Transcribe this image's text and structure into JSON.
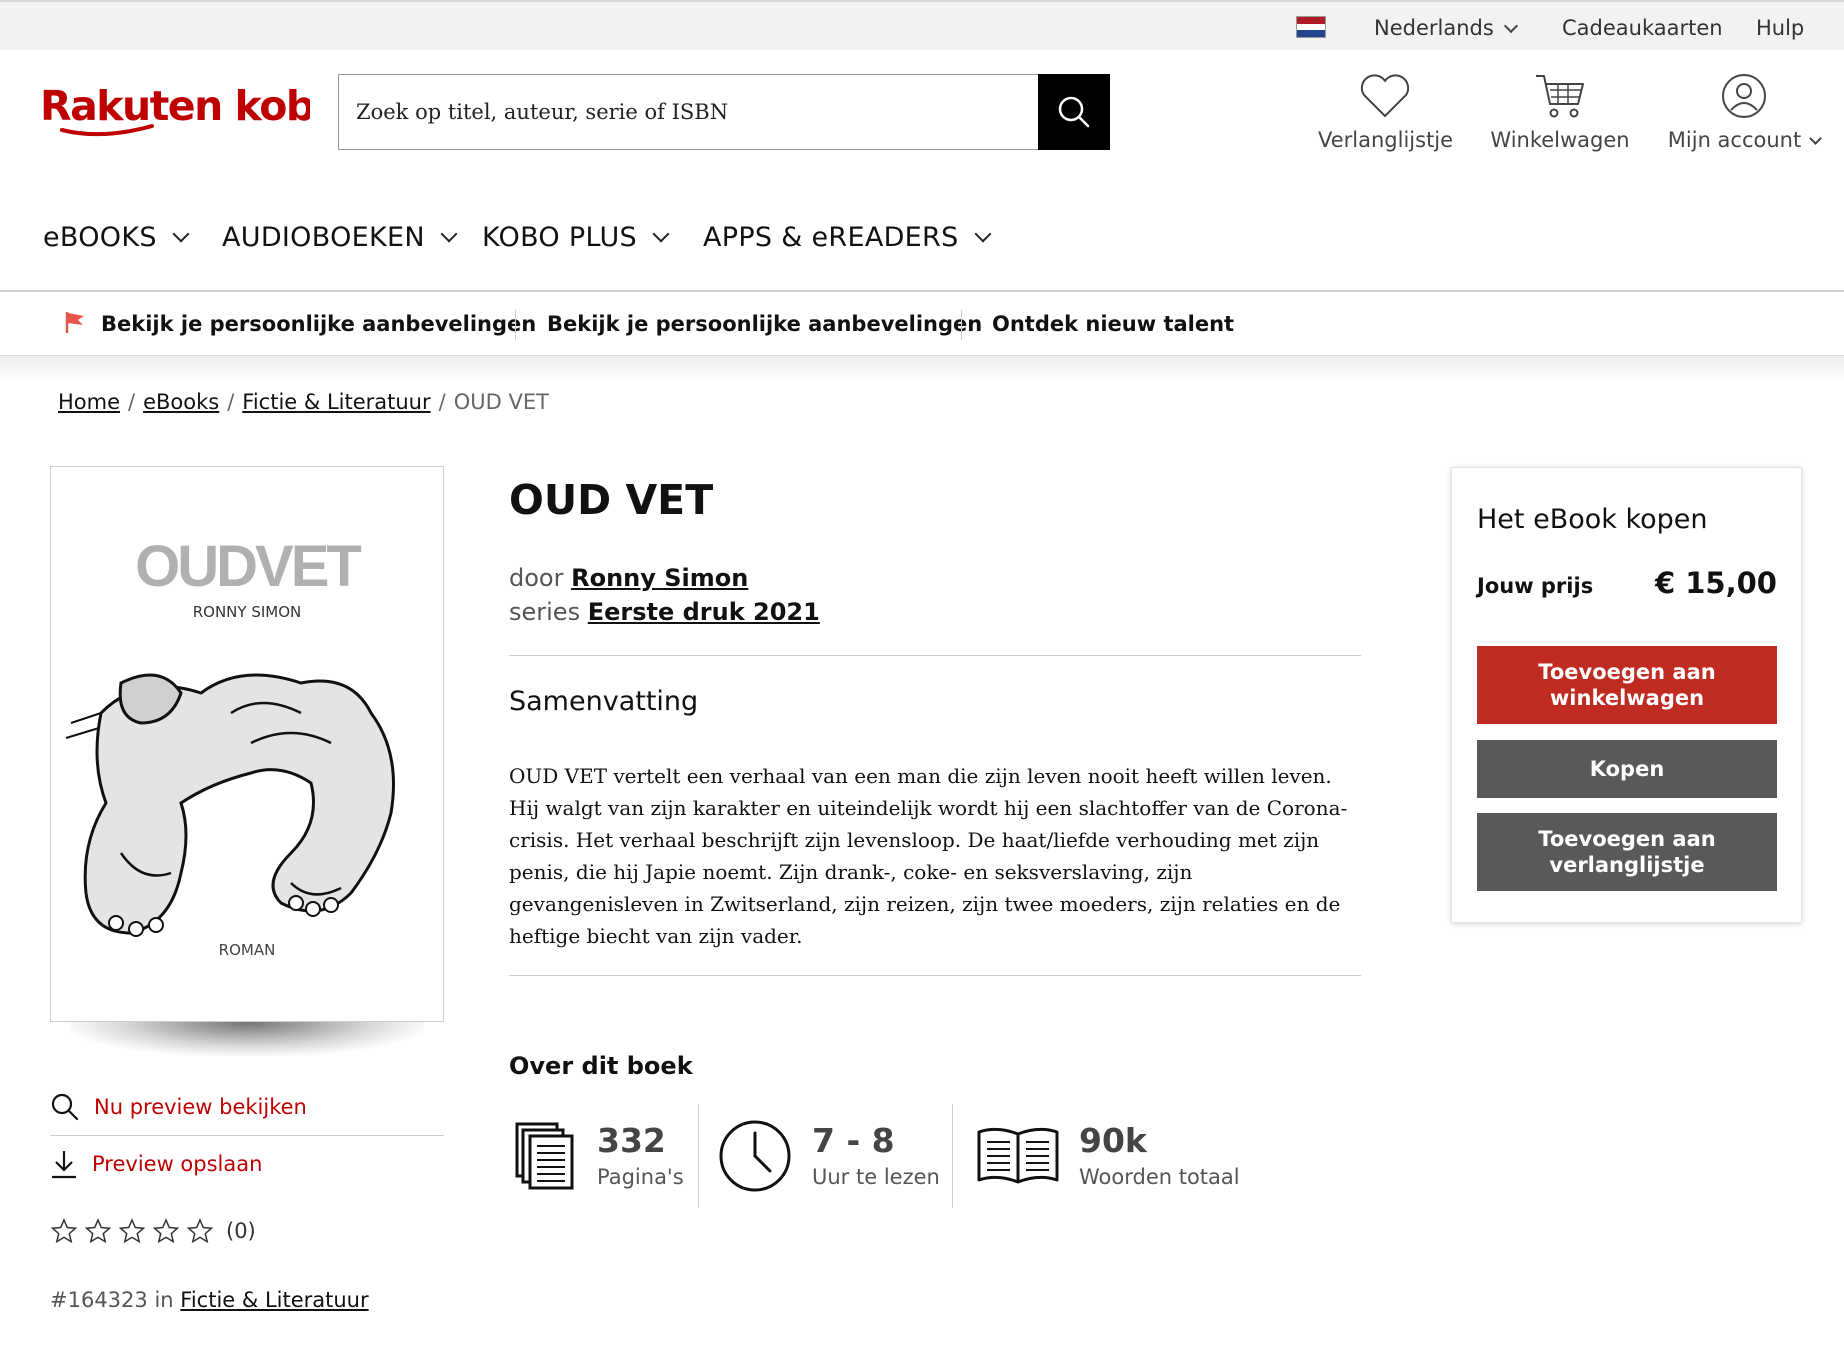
{
  "colors": {
    "brand_red": "#bf0000",
    "button_gray": "#595959",
    "link_red": "#bf0000",
    "utility_bg": "#f2f2f2"
  },
  "utility_bar": {
    "language": "Nederlands",
    "gift_cards": "Cadeaukaarten",
    "help": "Hulp",
    "flag_icon": "netherlands-flag-icon"
  },
  "header": {
    "logo_text": "Rakuten kobo",
    "search_placeholder": "Zoek op titel, auteur, serie of ISBN",
    "search_icon": "search-icon",
    "wishlist": "Verlanglijstje",
    "cart": "Winkelwagen",
    "account": "Mijn account"
  },
  "main_nav": [
    {
      "label": "eBOOKS"
    },
    {
      "label": "AUDIOBOEKEN"
    },
    {
      "label": "KOBO PLUS"
    },
    {
      "label": "APPS & eREADERS"
    }
  ],
  "promo_bar": [
    {
      "label": "Bekijk je persoonlijke aanbevelingen",
      "icon": "flag-icon"
    },
    {
      "label": "Bekijk je persoonlijke aanbevelingen"
    },
    {
      "label": "Ontdek nieuw talent"
    }
  ],
  "breadcrumb": {
    "items": [
      "Home",
      "eBooks",
      "Fictie & Literatuur"
    ],
    "current": "OUD VET",
    "separator": "/"
  },
  "cover": {
    "title": "OUDVET",
    "author": "RONNY SIMON",
    "label": "ROMAN"
  },
  "preview": {
    "view": "Nu preview bekijken",
    "save": "Preview opslaan"
  },
  "rating": {
    "stars_filled": 0,
    "stars_total": 5,
    "count": "(0)"
  },
  "rank": {
    "number": "#164323",
    "in": "in",
    "category": "Fictie & Literatuur"
  },
  "book": {
    "title": "OUD VET",
    "by_label": "door",
    "author": "Ronny Simon",
    "series_label": "series",
    "series": "Eerste druk 2021",
    "synopsis_heading": "Samenvatting",
    "synopsis": "OUD VET vertelt een verhaal van een man die zijn leven nooit heeft willen leven. Hij walgt van zijn karakter en uiteindelijk wordt hij een slachtoffer van de Corona-crisis. Het verhaal beschrijft zijn levensloop. De haat/liefde verhouding met zijn penis, die hij Japie noemt. Zijn drank-, coke- en seksverslaving, zijn gevangenisleven in Zwitserland, zijn reizen, zijn twee moeders, zijn relaties en de heftige biecht van zijn vader."
  },
  "about": {
    "heading": "Over dit boek",
    "stats": [
      {
        "value": "332",
        "label": "Pagina's",
        "icon": "pages-icon"
      },
      {
        "value": "7 - 8",
        "label": "Uur te lezen",
        "icon": "clock-icon"
      },
      {
        "value": "90k",
        "label": "Woorden totaal",
        "icon": "open-book-icon"
      }
    ]
  },
  "buybox": {
    "heading": "Het eBook kopen",
    "price_label": "Jouw prijs",
    "price": "€ 15,00",
    "add_to_cart": "Toevoegen aan winkelwagen",
    "buy": "Kopen",
    "add_to_wishlist": "Toevoegen aan verlanglijstje"
  }
}
